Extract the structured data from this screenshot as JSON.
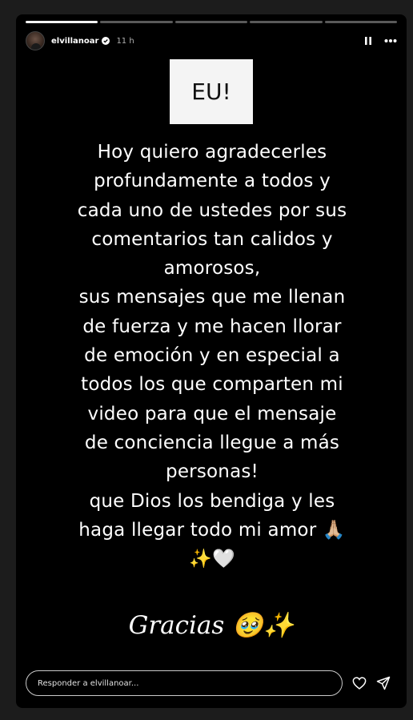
{
  "story": {
    "username": "elvillanoar",
    "time": "11 h",
    "verified_icon": "verified-badge-icon",
    "progress_segments": 5,
    "active_segment": 0
  },
  "content": {
    "box_text": "EU!",
    "message": "Hoy quiero agradecerles\nprofundamente a todos y\ncada uno de ustedes por sus\ncomentarios tan calidos y\namorosos,\nsus mensajes que me llenan\nde fuerza y me hacen llorar\nde emoción y en especial a\ntodos los que comparten mi\nvideo para que el mensaje\nde conciencia llegue a más\npersonas!\nque Dios los bendiga y les\nhaga llegar todo mi amor 🙏🏼\n✨🤍",
    "gracias": "Gracias 🥹✨"
  },
  "reply": {
    "placeholder": "Responder a elvillanoar..."
  },
  "icons": {
    "pause": "pause-icon",
    "more": "more-icon",
    "heart": "heart-icon",
    "send": "send-icon"
  },
  "colors": {
    "story_background": "#000000",
    "page_background": "#1c1c1c",
    "text": "#ffffff",
    "box_background": "#f4f4f4"
  }
}
